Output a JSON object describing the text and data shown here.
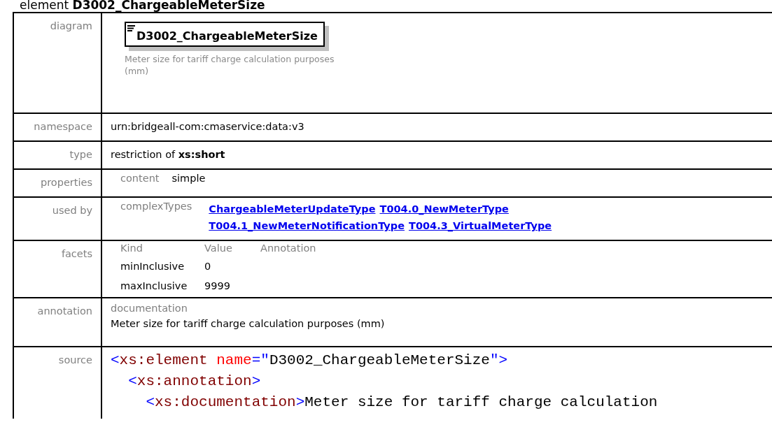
{
  "heading": {
    "prefix": "element",
    "name": "D3002_ChargeableMeterSize"
  },
  "diagram": {
    "label": "diagram",
    "element_name": "D3002_ChargeableMeterSize",
    "description": "Meter size for tariff charge calculation purposes (mm)"
  },
  "namespace": {
    "label": "namespace",
    "value": "urn:bridgeall-com:cmaservice:data:v3"
  },
  "type": {
    "label": "type",
    "value": "restriction of **xs:short**"
  },
  "properties": {
    "label": "properties",
    "items": [
      {
        "name": "content",
        "value": "simple"
      }
    ]
  },
  "used_by": {
    "label": "used by",
    "group": "complexTypes",
    "links": [
      "ChargeableMeterUpdateType",
      "T004.0_NewMeterType",
      "T004.1_NewMeterNotificationType",
      "T004.3_VirtualMeterType"
    ]
  },
  "facets": {
    "label": "facets",
    "columns": [
      "Kind",
      "Value",
      "Annotation"
    ],
    "rows": [
      {
        "kind": "minInclusive",
        "value": "0"
      },
      {
        "kind": "maxInclusive",
        "value": "9999"
      }
    ]
  },
  "annotation": {
    "label": "annotation",
    "heading": "documentation",
    "text": "Meter size for tariff charge calculation purposes (mm)"
  },
  "source": {
    "label": "source",
    "lines": [
      {
        "tokens": [
          {
            "kind": "punct",
            "text": "<"
          },
          {
            "kind": "tag",
            "text": "xs:element"
          },
          {
            "kind": "attr",
            "text": " name"
          },
          {
            "kind": "punct",
            "text": "=\""
          },
          {
            "kind": "value",
            "text": "D3002_ChargeableMeterSize"
          },
          {
            "kind": "punct",
            "text": "\">"
          }
        ],
        "children": [
          {
            "tokens": [
              {
                "kind": "punct",
                "text": "<"
              },
              {
                "kind": "tag",
                "text": "xs:annotation"
              },
              {
                "kind": "punct",
                "text": ">"
              }
            ],
            "children": [
              {
                "tokens": [
                  {
                    "kind": "punct",
                    "text": "<"
                  },
                  {
                    "kind": "tag",
                    "text": "xs:documentation"
                  },
                  {
                    "kind": "punct",
                    "text": ">"
                  },
                  {
                    "kind": "value",
                    "text": "Meter size for tariff charge calculation"
                  }
                ]
              }
            ]
          }
        ]
      }
    ]
  }
}
